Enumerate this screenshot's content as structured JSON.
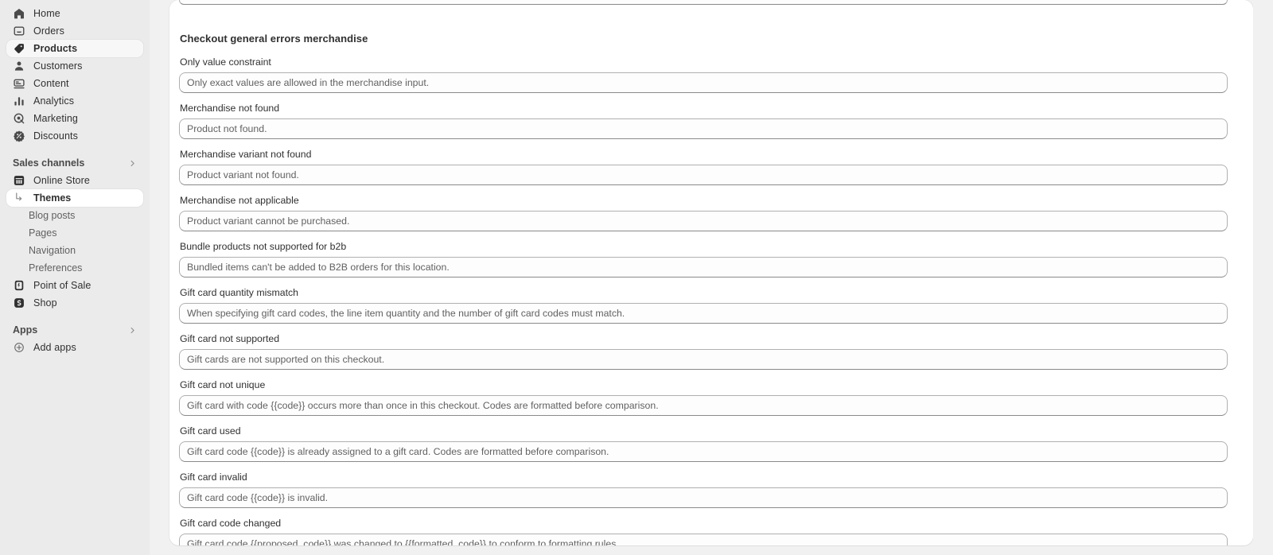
{
  "sidebar": {
    "primary_items": [
      {
        "label": "Home",
        "icon": "home-icon",
        "active": false
      },
      {
        "label": "Orders",
        "icon": "orders-icon",
        "active": false
      },
      {
        "label": "Products",
        "icon": "tag-icon",
        "active": true
      },
      {
        "label": "Customers",
        "icon": "person-icon",
        "active": false
      },
      {
        "label": "Content",
        "icon": "content-icon",
        "active": false
      },
      {
        "label": "Analytics",
        "icon": "bar-chart-icon",
        "active": false
      },
      {
        "label": "Marketing",
        "icon": "target-icon",
        "active": false
      },
      {
        "label": "Discounts",
        "icon": "discount-icon",
        "active": false
      }
    ],
    "sales_channels": {
      "header": "Sales channels",
      "chevron": "chevron-right-icon",
      "items": [
        {
          "label": "Online Store",
          "icon": "store-icon",
          "type": "channel",
          "active": false
        },
        {
          "label": "Themes",
          "icon": "branch-arrow-icon",
          "type": "sub",
          "active": true
        },
        {
          "label": "Blog posts",
          "icon": "",
          "type": "sub",
          "active": false
        },
        {
          "label": "Pages",
          "icon": "",
          "type": "sub",
          "active": false
        },
        {
          "label": "Navigation",
          "icon": "",
          "type": "sub",
          "active": false
        },
        {
          "label": "Preferences",
          "icon": "",
          "type": "sub",
          "active": false
        },
        {
          "label": "Point of Sale",
          "icon": "pos-icon",
          "type": "channel",
          "active": false
        },
        {
          "label": "Shop",
          "icon": "shop-icon",
          "type": "channel",
          "active": false
        }
      ]
    },
    "apps": {
      "header": "Apps",
      "chevron": "chevron-right-icon",
      "items": [
        {
          "label": "Add apps",
          "icon": "plus-circle-icon"
        }
      ]
    }
  },
  "main": {
    "section_title": "Checkout general errors merchandise",
    "fields": [
      {
        "label": "Only value constraint",
        "value": "Only exact values are allowed in the merchandise input."
      },
      {
        "label": "Merchandise not found",
        "value": "Product not found."
      },
      {
        "label": "Merchandise variant not found",
        "value": "Product variant not found."
      },
      {
        "label": "Merchandise not applicable",
        "value": "Product variant cannot be purchased."
      },
      {
        "label": "Bundle products not supported for b2b",
        "value": "Bundled items can't be added to B2B orders for this location."
      },
      {
        "label": "Gift card quantity mismatch",
        "value": "When specifying gift card codes, the line item quantity and the number of gift card codes must match."
      },
      {
        "label": "Gift card not supported",
        "value": "Gift cards are not supported on this checkout."
      },
      {
        "label": "Gift card not unique",
        "value": "Gift card with code {{code}} occurs more than once in this checkout. Codes are formatted before comparison."
      },
      {
        "label": "Gift card used",
        "value": "Gift card code {{code}} is already assigned to a gift card. Codes are formatted before comparison."
      },
      {
        "label": "Gift card invalid",
        "value": "Gift card code {{code}} is invalid."
      },
      {
        "label": "Gift card code changed",
        "value": "Gift card code {{proposed_code}} was changed to {{formatted_code}} to conform to formatting rules."
      }
    ]
  },
  "colors": {
    "sidebar_bg": "#ebebeb",
    "page_bg": "#f1f1f1",
    "card_bg": "#ffffff",
    "text_primary": "#303030",
    "text_secondary": "#616161",
    "input_border": "#b0b0b0"
  }
}
